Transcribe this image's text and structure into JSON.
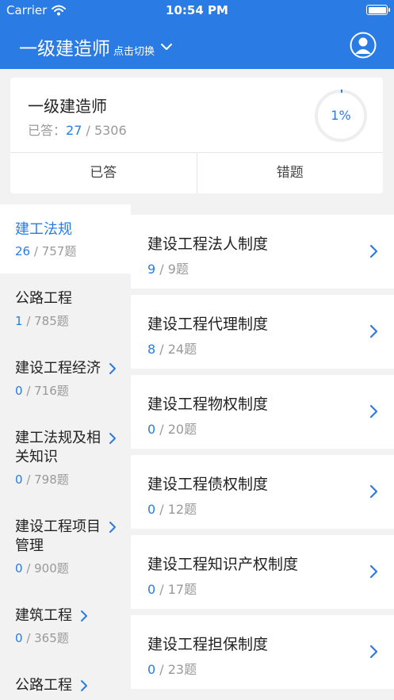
{
  "status_bar": {
    "carrier": "Carrier",
    "time": "10:54 PM"
  },
  "nav": {
    "title": "一级建造师",
    "switch_label": "点击切换"
  },
  "summary": {
    "title": "一级建造师",
    "answered_label": "已答：",
    "answered": "27",
    "separator": " / ",
    "total": "5306",
    "progress_label": "1%",
    "progress_fraction": 0.01,
    "tab_answered": "已答",
    "tab_wrong": "错题"
  },
  "sidebar": {
    "items": [
      {
        "title": "建工法规",
        "answered": "26",
        "total": "757题"
      },
      {
        "title": "公路工程",
        "answered": "1",
        "total": "785题"
      },
      {
        "title": "建设工程经济",
        "answered": "0",
        "total": "716题"
      },
      {
        "title": "建工法规及相关知识",
        "answered": "0",
        "total": "798题"
      },
      {
        "title": "建设工程项目管理",
        "answered": "0",
        "total": "900题"
      },
      {
        "title": "建筑工程",
        "answered": "0",
        "total": "365题"
      },
      {
        "title": "公路工程",
        "answered": "",
        "total": ""
      }
    ]
  },
  "chapters": [
    {
      "title": "建设工程法人制度",
      "answered": "9",
      "total": "9题"
    },
    {
      "title": "建设工程代理制度",
      "answered": "8",
      "total": "24题"
    },
    {
      "title": "建设工程物权制度",
      "answered": "0",
      "total": "20题"
    },
    {
      "title": "建设工程债权制度",
      "answered": "0",
      "total": "12题"
    },
    {
      "title": "建设工程知识产权制度",
      "answered": "0",
      "total": "17题"
    },
    {
      "title": "建设工程担保制度",
      "answered": "0",
      "total": "23题"
    }
  ],
  "colors": {
    "accent": "#2a7be4",
    "background": "#f2f2f2"
  },
  "icons": {
    "wifi": "wifi-icon",
    "battery": "battery-icon",
    "dropdown": "chevron-down-icon",
    "profile": "profile-icon",
    "row": "chevron-right-icon"
  }
}
